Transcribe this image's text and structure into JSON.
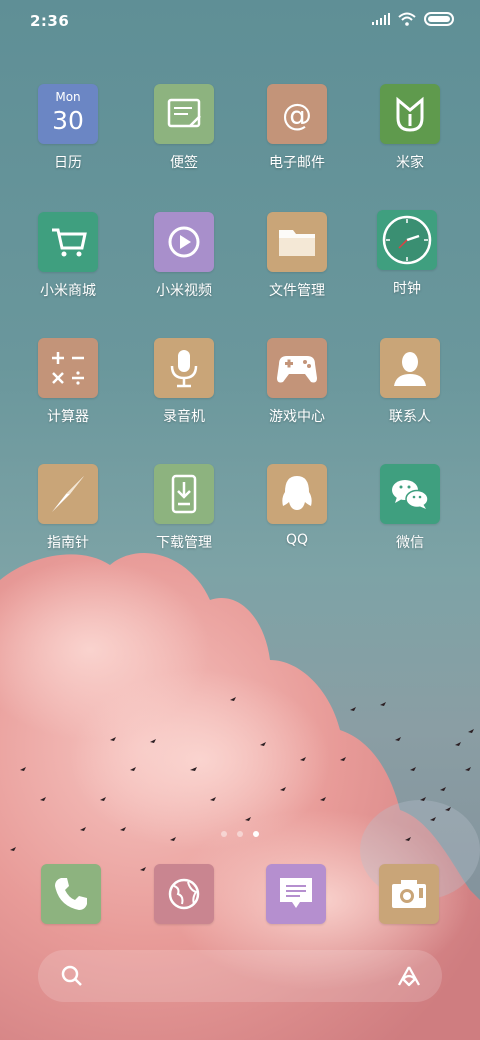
{
  "status_bar": {
    "time": "2:36",
    "icons": [
      "signal-icon",
      "wifi-icon",
      "battery-icon"
    ]
  },
  "home": {
    "apps": [
      {
        "label": "日历",
        "icon": "calendar-icon",
        "color": "#6b86c4",
        "calendar_day": "Mon",
        "calendar_date": "30"
      },
      {
        "label": "便签",
        "icon": "notes-icon",
        "color": "#8db37f"
      },
      {
        "label": "电子邮件",
        "icon": "email-icon",
        "color": "#c39479"
      },
      {
        "label": "米家",
        "icon": "mijia-icon",
        "color": "#5f9a4d"
      },
      {
        "label": "小米商城",
        "icon": "cart-icon",
        "color": "#3f9f7f"
      },
      {
        "label": "小米视频",
        "icon": "video-play-icon",
        "color": "#a88fcb"
      },
      {
        "label": "文件管理",
        "icon": "folder-icon",
        "color": "#c9a578"
      },
      {
        "label": "时钟",
        "icon": "clock-icon",
        "color": "#3f9f7f"
      },
      {
        "label": "计算器",
        "icon": "calculator-icon",
        "color": "#c39479"
      },
      {
        "label": "录音机",
        "icon": "microphone-icon",
        "color": "#c9a578"
      },
      {
        "label": "游戏中心",
        "icon": "gamepad-icon",
        "color": "#c39479"
      },
      {
        "label": "联系人",
        "icon": "contact-person-icon",
        "color": "#c9a578"
      },
      {
        "label": "指南针",
        "icon": "compass-icon",
        "color": "#c9a578"
      },
      {
        "label": "下载管理",
        "icon": "download-icon",
        "color": "#8db37f"
      },
      {
        "label": "QQ",
        "icon": "qq-penguin-icon",
        "color": "#c9a578"
      },
      {
        "label": "微信",
        "icon": "wechat-icon",
        "color": "#3f9f7f"
      }
    ],
    "page_indicator": {
      "count": 3,
      "active_index": 2
    }
  },
  "dock": {
    "apps": [
      {
        "icon": "phone-icon",
        "color": "#8db37f"
      },
      {
        "icon": "browser-globe-icon",
        "color": "#c98590"
      },
      {
        "icon": "messages-icon",
        "color": "#b58fcf"
      },
      {
        "icon": "camera-icon",
        "color": "#c9a578"
      }
    ]
  },
  "search_bar": {
    "left_icon": "search-icon",
    "right_icon": "assistant-icon"
  }
}
